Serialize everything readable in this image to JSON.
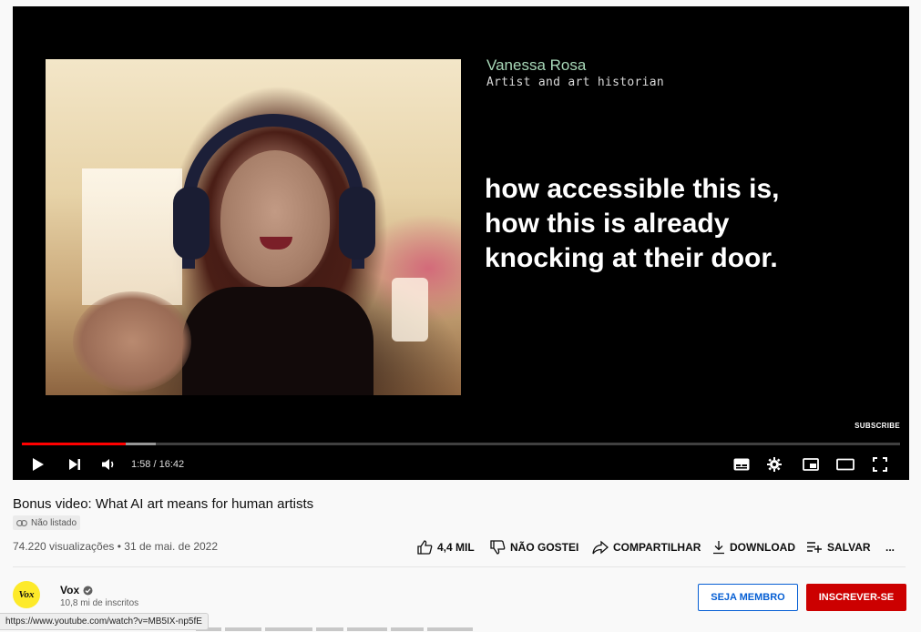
{
  "video": {
    "speaker_name": "Vanessa Rosa",
    "speaker_role": "Artist and art historian",
    "quote": "how accessible this is,\nhow this is already\nknocking at their door.",
    "subscribe_watermark": "SUBSCRIBE",
    "time_display": "1:58 / 16:42",
    "progress_played": 0.118,
    "progress_buffered": 0.152
  },
  "meta": {
    "title": "Bonus video: What AI art means for human artists",
    "visibility": "Não listado",
    "views_date": "74.220 visualizações • 31 de mai. de 2022"
  },
  "actions": {
    "like": "4,4 MIL",
    "dislike": "NÃO GOSTEI",
    "share": "COMPARTILHAR",
    "download": "DOWNLOAD",
    "save": "SALVAR",
    "more": "..."
  },
  "channel": {
    "avatar_text": "Vox",
    "name": "Vox",
    "subscribers": "10,8 mi de inscritos",
    "member_button": "SEJA MEMBRO",
    "subscribe_button": "INSCREVER-SE"
  },
  "statusbar": {
    "url": "https://www.youtube.com/watch?v=MB5IX-np5fE"
  },
  "colors": {
    "progress_red": "#ff0000",
    "subscribe_red": "#cc0000",
    "member_blue": "#065fd4",
    "avatar_yellow": "#fdea2a"
  }
}
